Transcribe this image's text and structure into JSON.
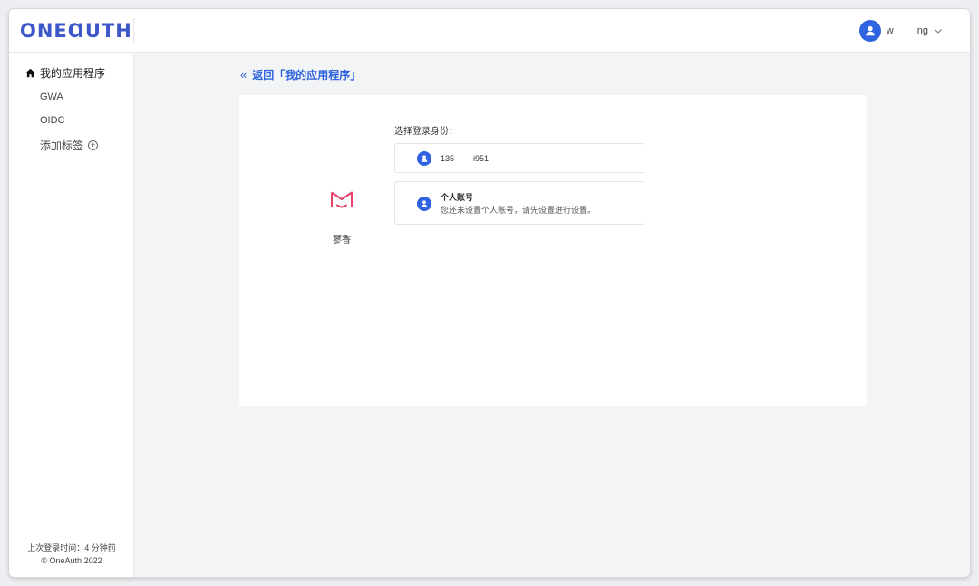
{
  "header": {
    "logo_text": "ONEⱭUTH",
    "user": {
      "name_part1": "w",
      "name_part2": "ng",
      "avatar_icon": "user-avatar-icon",
      "dropdown_icon": "chevron-down-icon"
    }
  },
  "sidebar": {
    "home": {
      "label": "我的应用程序",
      "icon": "home-icon"
    },
    "items": [
      {
        "label": "GWA"
      },
      {
        "label": "OIDC"
      }
    ],
    "add_tag": {
      "label": "添加标签",
      "icon": "plus-circle-icon"
    },
    "footer": {
      "last_login": "上次登录时间：4 分钟前",
      "copyright": "© OneAuth 2022"
    }
  },
  "main": {
    "back_link": {
      "arrow": "«",
      "label": "返回「我的应用程序」"
    },
    "app": {
      "name": "寥香",
      "icon": "app-logo-icon"
    },
    "choose_label": "选择登录身份：",
    "identities": [
      {
        "part1": "135",
        "part2": "i951",
        "icon": "user-icon"
      },
      {
        "title": "个人账号",
        "subtitle": "您还未设置个人账号，请先设置进行设置。",
        "icon": "user-icon"
      }
    ]
  },
  "colors": {
    "accent": "#2f63e0",
    "logo": "#3d56c8",
    "app_logo": "#e8416a",
    "background": "#f3f4f6"
  }
}
